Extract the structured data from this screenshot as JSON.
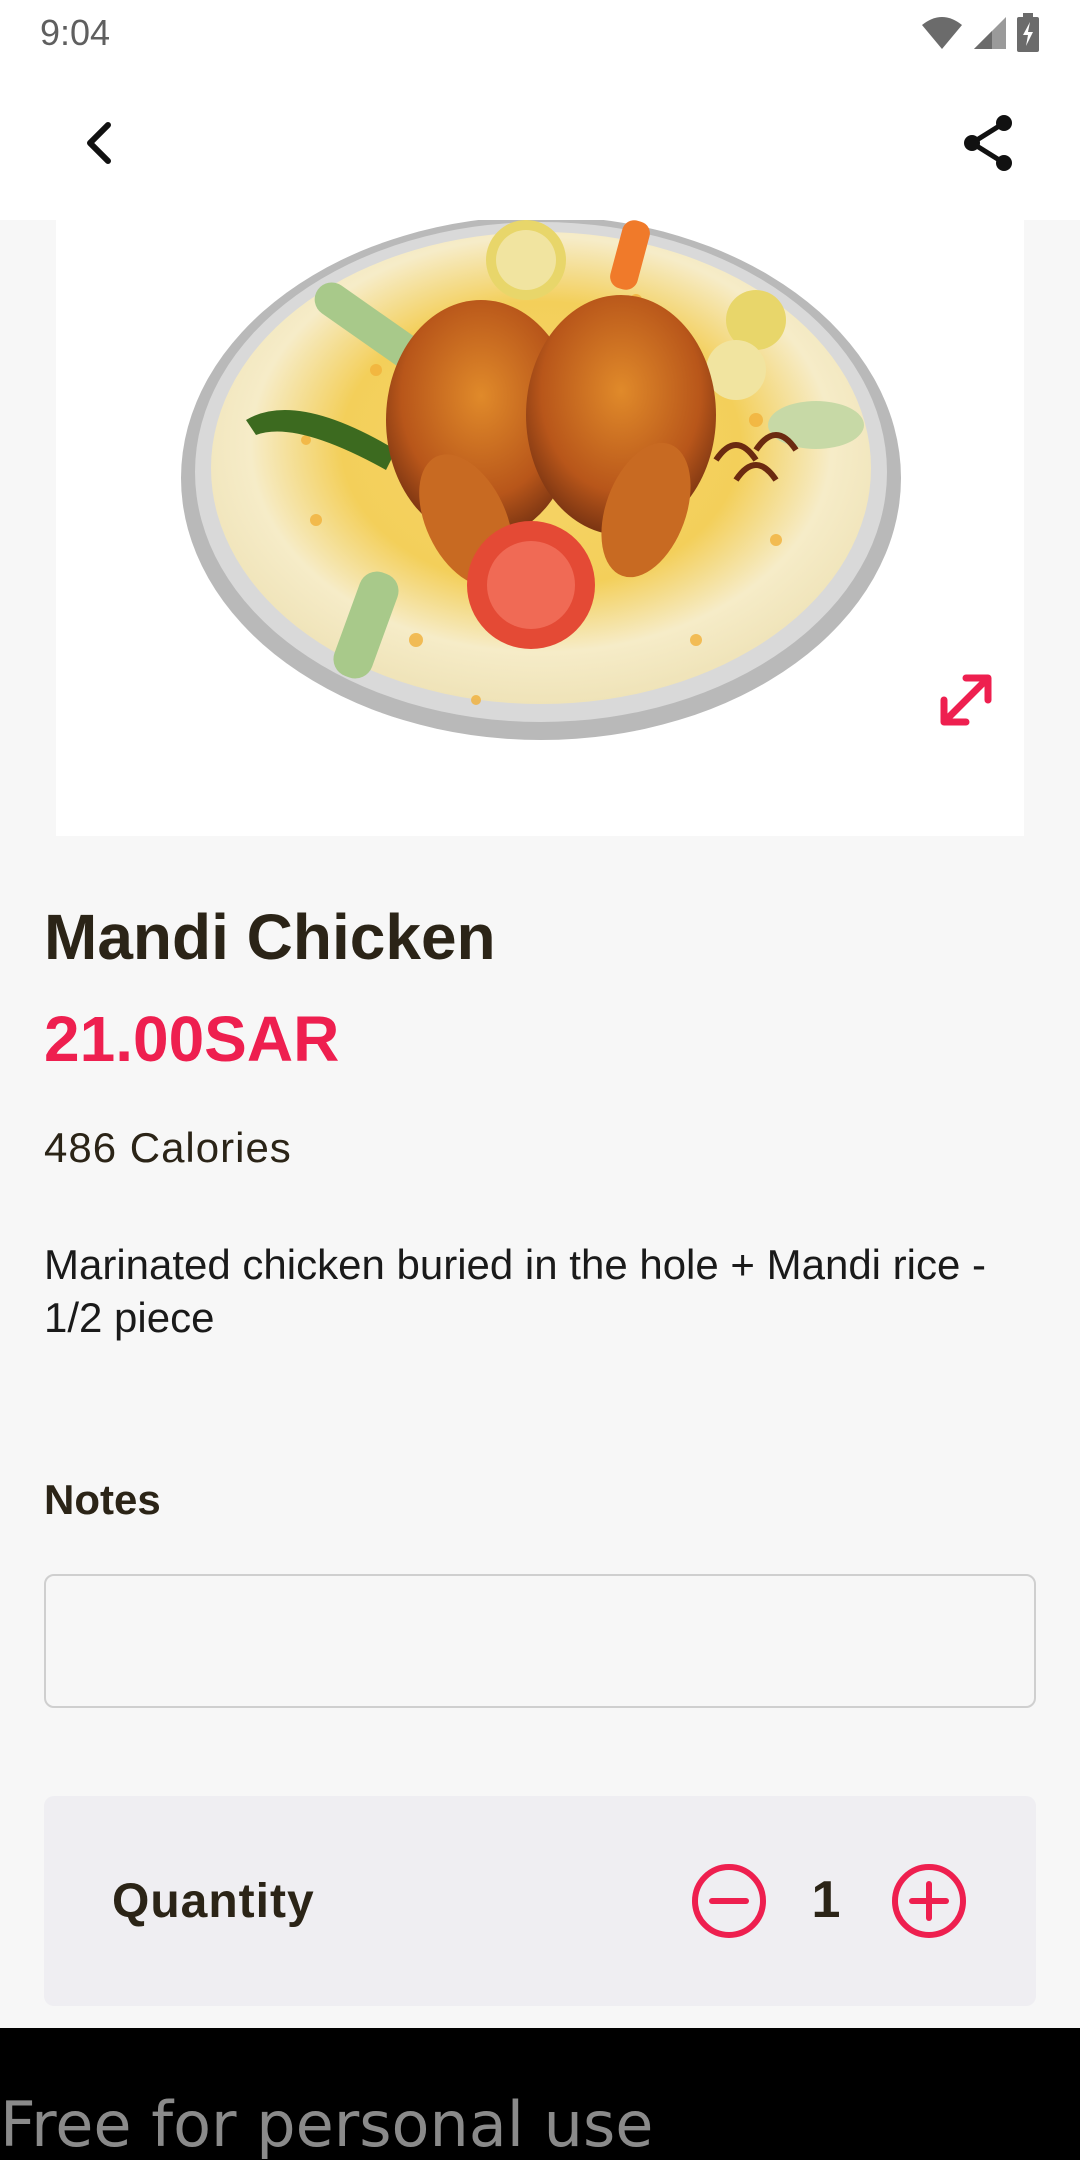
{
  "status_bar": {
    "time": "9:04",
    "icons": [
      "wifi-icon",
      "signal-icon",
      "battery-icon"
    ]
  },
  "app_bar": {
    "back_icon": "chevron-left-icon",
    "share_icon": "share-icon"
  },
  "product": {
    "name": "Mandi Chicken",
    "price": "21.00SAR",
    "calories": "486 Calories",
    "description": "Marinated chicken buried in the hole + Mandi rice - 1/2 piece",
    "image_icon": "food-image",
    "expand_icon": "expand-icon"
  },
  "notes": {
    "label": "Notes",
    "value": "",
    "placeholder": ""
  },
  "quantity": {
    "label": "Quantity",
    "value": "1",
    "minus_icon": "minus-circle-icon",
    "plus_icon": "plus-circle-icon"
  },
  "watermark": {
    "text": "Free for personal use"
  },
  "colors": {
    "accent": "#ee1f4f",
    "text": "#2b2417",
    "background": "#f7f7f7"
  }
}
